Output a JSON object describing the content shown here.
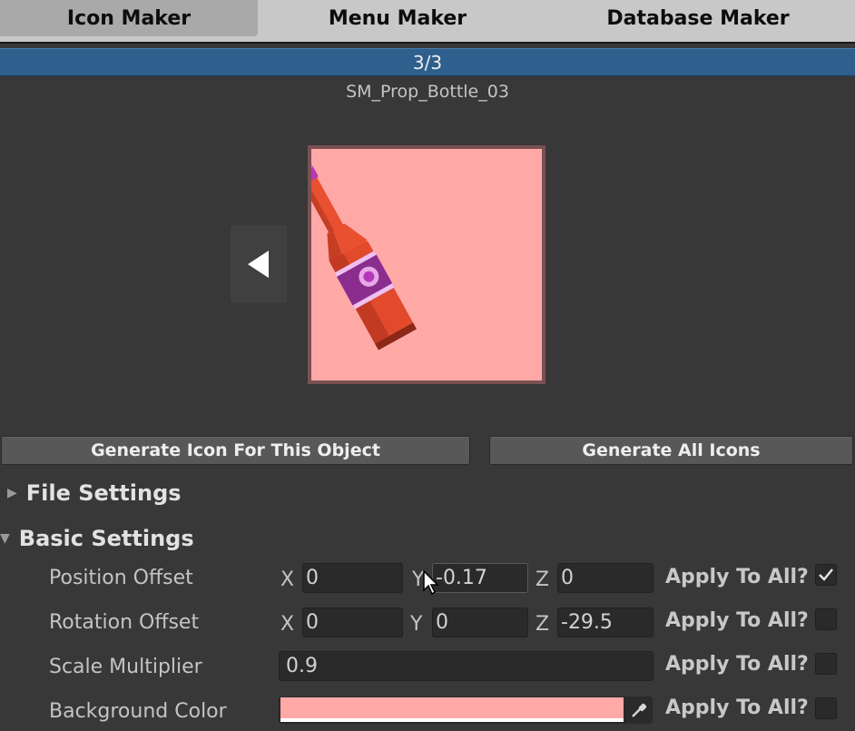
{
  "tabs": [
    {
      "label": "Icon Maker",
      "selected": true
    },
    {
      "label": "Menu Maker",
      "selected": false
    },
    {
      "label": "Database Maker",
      "selected": false
    }
  ],
  "progress": {
    "text": "3/3",
    "value": 1.0
  },
  "object_name": "SM_Prop_Bottle_03",
  "preview": {
    "background_color": "#ffa9a7",
    "icons": [
      "prev-arrow-icon",
      "bottle-icon"
    ]
  },
  "buttons": {
    "generate_one": "Generate Icon For This Object",
    "generate_all": "Generate All Icons"
  },
  "sections": {
    "file_settings": "File Settings",
    "basic_settings": "Basic Settings"
  },
  "settings": {
    "position_offset": {
      "label": "Position Offset",
      "x_label": "X",
      "x": "0",
      "y_label": "Y",
      "y": "-0.17",
      "z_label": "Z",
      "z": "0",
      "apply_label": "Apply To All?",
      "apply": true
    },
    "rotation_offset": {
      "label": "Rotation Offset",
      "x_label": "X",
      "x": "0",
      "y_label": "Y",
      "y": "0",
      "z_label": "Z",
      "z": "-29.5",
      "apply_label": "Apply To All?",
      "apply": false
    },
    "scale_multiplier": {
      "label": "Scale Multiplier",
      "value": "0.9",
      "apply_label": "Apply To All?",
      "apply": false
    },
    "background_color": {
      "label": "Background Color",
      "value": "#ffa9a7",
      "apply_label": "Apply To All?",
      "apply": false
    }
  }
}
